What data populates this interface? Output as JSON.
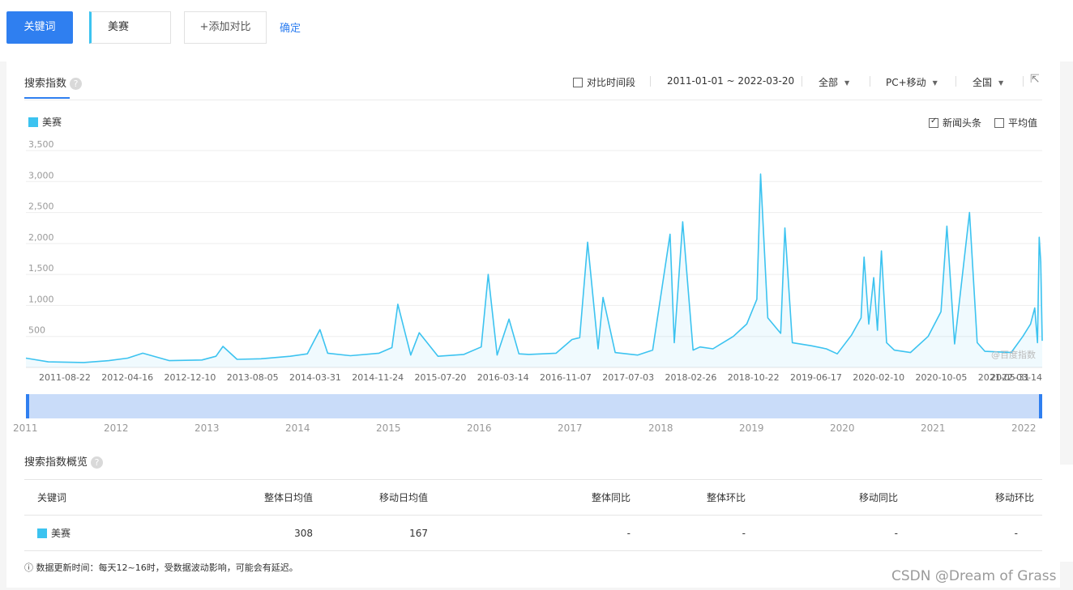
{
  "topbar": {
    "keyword_button": "关键词",
    "keyword": "美赛",
    "add_compare": "+添加对比",
    "confirm": "确定"
  },
  "panel": {
    "tab_title": "搜索指数",
    "help_icon": "question-icon",
    "compare_period": "对比时间段",
    "date_range": "2011-01-01 ~ 2022-03-20",
    "region_scope": "全部",
    "device": "PC+移动",
    "area": "全国",
    "export_icon": "external-link-icon",
    "news_headline": "新闻头条",
    "average": "平均值",
    "watermark": "@百度指数"
  },
  "chart_data": {
    "type": "area",
    "series": [
      {
        "name": "美赛",
        "color": "#3cc3f0"
      }
    ],
    "x_dates": [
      "2011-01-01",
      "2011-04-01",
      "2011-08-22",
      "2011-12-01",
      "2012-02-15",
      "2012-04-16",
      "2012-08-01",
      "2012-12-10",
      "2013-02-05",
      "2013-03-05",
      "2013-05-01",
      "2013-08-05",
      "2013-12-01",
      "2014-02-08",
      "2014-03-31",
      "2014-05-01",
      "2014-08-01",
      "2014-11-24",
      "2015-01-15",
      "2015-02-08",
      "2015-04-01",
      "2015-05-05",
      "2015-07-20",
      "2015-11-01",
      "2016-01-10",
      "2016-02-07",
      "2016-03-14",
      "2016-05-01",
      "2016-06-10",
      "2016-07-20",
      "2016-11-07",
      "2017-01-10",
      "2017-02-10",
      "2017-03-14",
      "2017-04-25",
      "2017-05-15",
      "2017-07-03",
      "2017-10-01",
      "2017-12-01",
      "2018-02-09",
      "2018-02-26",
      "2018-04-01",
      "2018-05-13",
      "2018-06-10",
      "2018-08-01",
      "2018-10-22",
      "2018-12-15",
      "2019-01-25",
      "2019-02-09",
      "2019-03-10",
      "2019-05-01",
      "2019-05-18",
      "2019-06-17",
      "2019-09-01",
      "2019-11-01",
      "2019-12-15",
      "2020-02-10",
      "2020-03-20",
      "2020-04-01",
      "2020-04-20",
      "2020-05-10",
      "2020-05-25",
      "2020-06-10",
      "2020-07-01",
      "2020-08-01",
      "2020-10-05",
      "2020-12-15",
      "2021-02-05",
      "2021-03-01",
      "2021-04-01",
      "2021-05-31",
      "2021-07-01",
      "2021-08-01",
      "2021-11-15",
      "2022-01-01",
      "2022-02-01",
      "2022-02-18",
      "2022-03-01",
      "2022-03-08",
      "2022-03-14",
      "2022-03-20"
    ],
    "values": [
      150,
      90,
      80,
      110,
      150,
      230,
      110,
      120,
      180,
      340,
      130,
      140,
      180,
      220,
      610,
      230,
      190,
      230,
      320,
      1020,
      200,
      560,
      180,
      210,
      330,
      1500,
      200,
      780,
      220,
      210,
      230,
      450,
      480,
      2020,
      300,
      1130,
      240,
      200,
      280,
      2150,
      400,
      2350,
      280,
      330,
      300,
      500,
      700,
      1100,
      3120,
      800,
      550,
      2250,
      400,
      350,
      300,
      220,
      520,
      800,
      1780,
      700,
      1450,
      600,
      1880,
      400,
      280,
      240,
      500,
      900,
      2280,
      380,
      2500,
      400,
      260,
      240,
      500,
      700,
      960,
      400,
      2100,
      1700,
      430
    ],
    "ylim": [
      0,
      3500
    ],
    "yticks": [
      500,
      1000,
      1500,
      2000,
      2500,
      3000,
      3500
    ],
    "ytick_labels": [
      "500",
      "1,000",
      "1,500",
      "2,000",
      "2,500",
      "3,000",
      "3,500"
    ],
    "xtick_labels": [
      "2011-08-22",
      "2012-04-16",
      "2012-12-10",
      "2013-08-05",
      "2014-03-31",
      "2014-11-24",
      "2015-07-20",
      "2016-03-14",
      "2016-11-07",
      "2017-07-03",
      "2018-02-26",
      "2018-10-22",
      "2019-06-17",
      "2020-02-10",
      "2020-10-05",
      "2021-05-31",
      "2022-03-14"
    ],
    "slider_year_labels": [
      "2011",
      "2012",
      "2013",
      "2014",
      "2015",
      "2016",
      "2017",
      "2018",
      "2019",
      "2020",
      "2021",
      "2022"
    ],
    "grid": true
  },
  "overview": {
    "title": "搜索指数概览",
    "columns": [
      "关键词",
      "整体日均值",
      "移动日均值",
      "整体同比",
      "整体环比",
      "移动同比",
      "移动环比"
    ],
    "rows": [
      {
        "keyword": "美赛",
        "overall_avg": "308",
        "mobile_avg": "167",
        "overall_yoy": "-",
        "overall_mom": "-",
        "mobile_yoy": "-",
        "mobile_mom": "-"
      }
    ],
    "note": "ⓘ 数据更新时间：每天12~16时，受数据波动影响，可能会有延迟。"
  },
  "watermark_text": "CSDN @Dream of Grass"
}
